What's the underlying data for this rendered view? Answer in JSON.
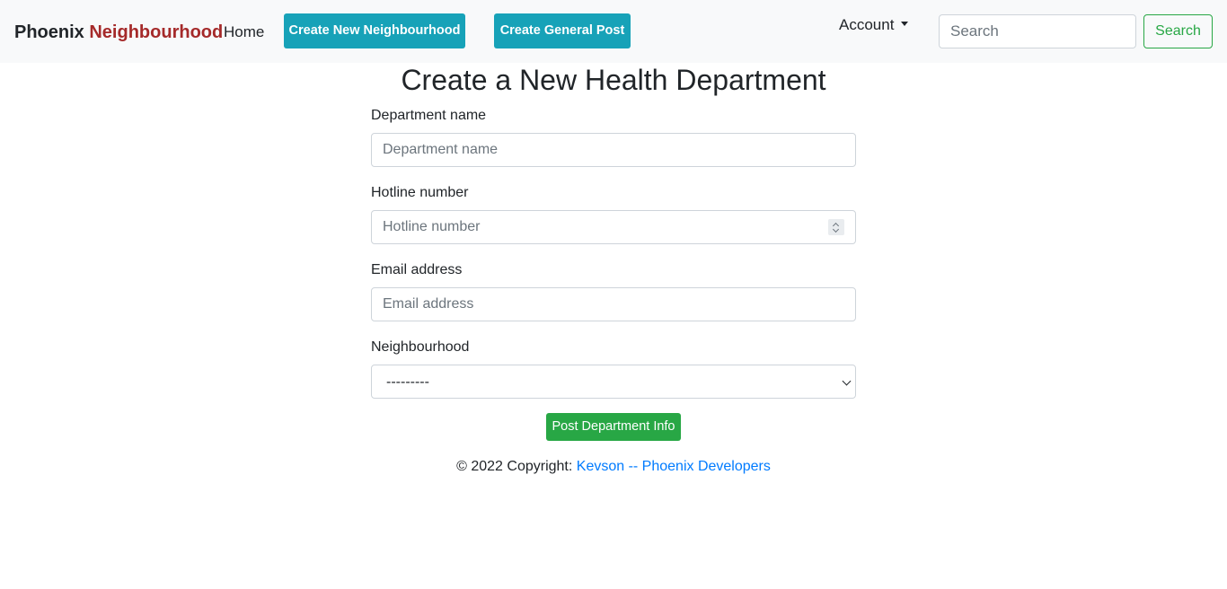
{
  "navbar": {
    "brand_part1": "Phoenix",
    "brand_part2": "Neighbourhood",
    "home_label": "Home",
    "create_neighbourhood_label": "Create New Neighbourhood",
    "create_post_label": "Create General Post",
    "account_label": "Account",
    "search_placeholder": "Search",
    "search_button_label": "Search"
  },
  "form": {
    "title": "Create a New Health Department",
    "department_name": {
      "label": "Department name",
      "placeholder": "Department name",
      "value": ""
    },
    "hotline_number": {
      "label": "Hotline number",
      "placeholder": "Hotline number",
      "value": ""
    },
    "email_address": {
      "label": "Email address",
      "placeholder": "Email address",
      "value": ""
    },
    "neighbourhood": {
      "label": "Neighbourhood",
      "selected": "---------"
    },
    "submit_label": "Post Department Info"
  },
  "footer": {
    "copyright_text": "© 2022 Copyright: ",
    "link_text": "Kevson -- Phoenix Developers"
  },
  "colors": {
    "navbar_bg": "#f8f9fa",
    "brand_accent": "#a52a2a",
    "info_button": "#17a2b8",
    "success": "#28a745",
    "link": "#007bff"
  },
  "icons": [
    "dropdown-caret-icon",
    "number-spinner-icon",
    "select-arrow-icon"
  ]
}
